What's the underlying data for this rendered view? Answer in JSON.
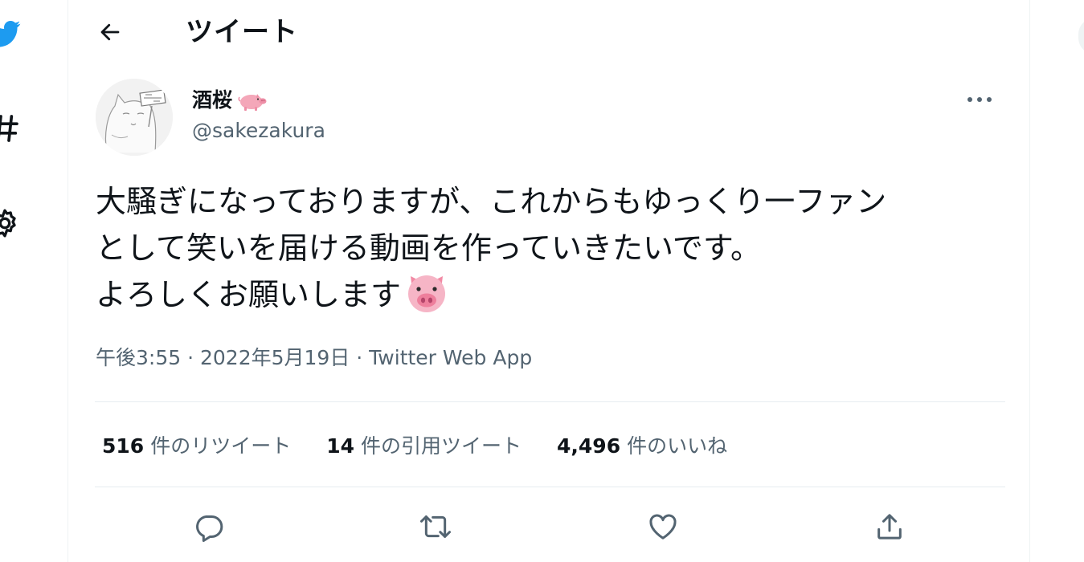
{
  "header": {
    "title": "ツイート",
    "back_icon": "arrow-left-icon"
  },
  "nav": {
    "icons": [
      "twitter-bird-icon",
      "hashtag-icon",
      "gear-icon"
    ],
    "brand_color": "#1d9bf0"
  },
  "tweet": {
    "display_name": "酒桜",
    "name_emoji": "pig-icon",
    "handle": "@sakezakura",
    "text": "大騒ぎになっておりますが、これからもゆっくり一ファン\nとして笑いを届ける動画を作っていきたいです。\nよろしくお願いします",
    "text_emoji": "pig-face-icon",
    "time": "午後3:55",
    "separator": " · ",
    "date": "2022年5月19日",
    "source": "Twitter Web App"
  },
  "stats": [
    {
      "count": "516",
      "label": "件のリツイート"
    },
    {
      "count": "14",
      "label": "件の引用ツイート"
    },
    {
      "count": "4,496",
      "label": "件のいいね"
    }
  ],
  "actions": [
    "reply-icon",
    "retweet-icon",
    "like-icon",
    "share-icon"
  ],
  "colors": {
    "text_primary": "#0f1419",
    "text_secondary": "#536471",
    "divider": "#e6ecf0",
    "pig_pink": "#f4a7b9"
  }
}
